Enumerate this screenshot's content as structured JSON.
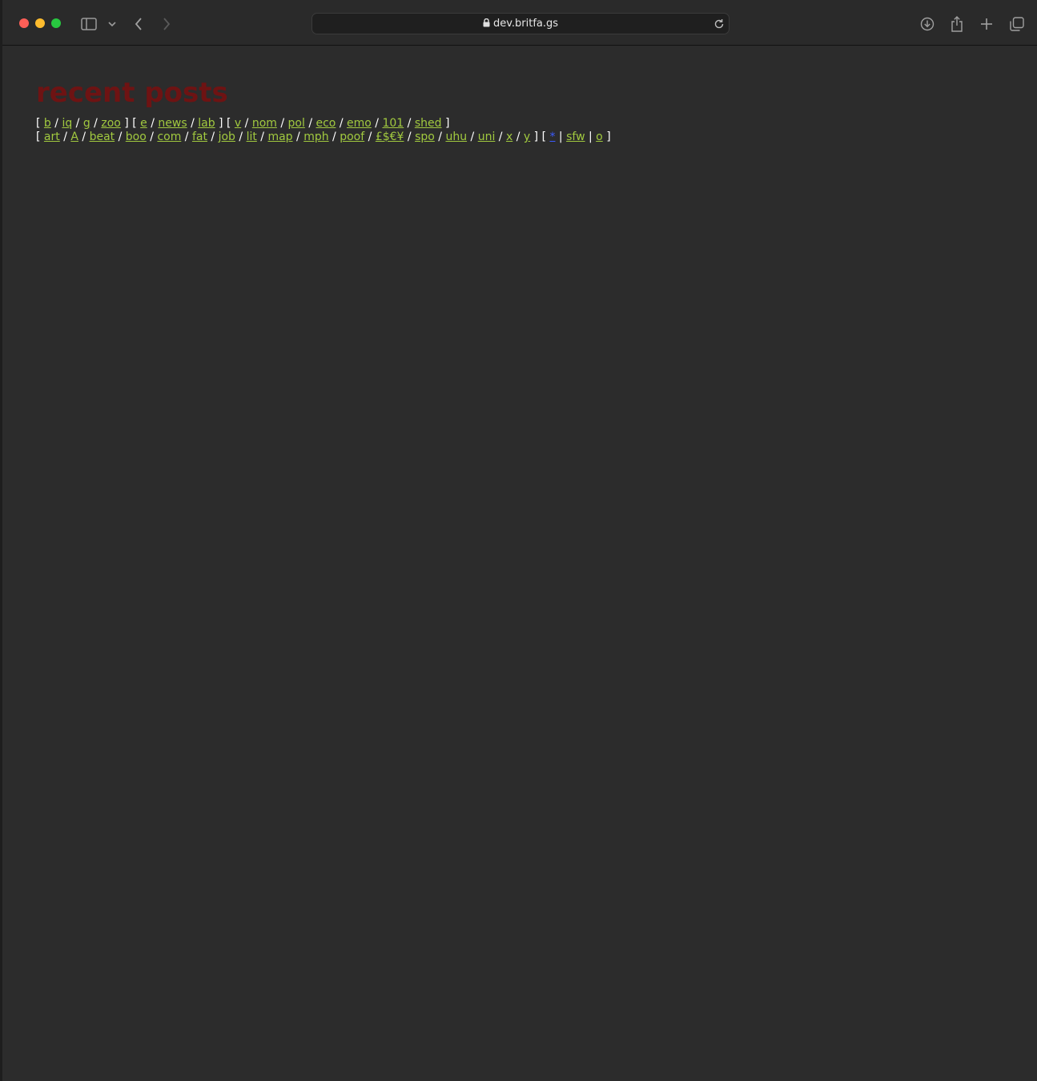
{
  "browser": {
    "url": "dev.britfa.gs"
  },
  "page": {
    "title": "recent posts",
    "nav_rows": [
      {
        "groups": [
          [
            "b",
            "iq",
            "g",
            "zoo"
          ],
          [
            "e",
            "news",
            "lab"
          ],
          [
            "v",
            "nom",
            "pol",
            "eco",
            "emo",
            "101",
            "shed"
          ]
        ]
      },
      {
        "groups": [
          [
            "art",
            "A",
            "beat",
            "boo",
            "com",
            "fat",
            "job",
            "lit",
            "map",
            "mph",
            "poof",
            "£$€¥",
            "spo",
            "uhu",
            "uni",
            "x",
            "y"
          ],
          [
            "*",
            "sfw",
            "o"
          ]
        ],
        "group_separators": [
          "/",
          "|"
        ]
      }
    ]
  },
  "colors": {
    "title": "#6e1313",
    "link": "#a1c93f",
    "star_link": "#3b5bff",
    "background": "#2c2c2c"
  },
  "icons": {
    "sidebar": "sidebar-icon",
    "sidebar_menu": "chevron-down-icon",
    "back": "chevron-left-icon",
    "forward": "chevron-right-icon",
    "lock": "lock-icon",
    "reload": "reload-icon",
    "downloads": "download-icon",
    "share": "share-icon",
    "new_tab": "plus-icon",
    "tabs": "tabs-overview-icon"
  }
}
